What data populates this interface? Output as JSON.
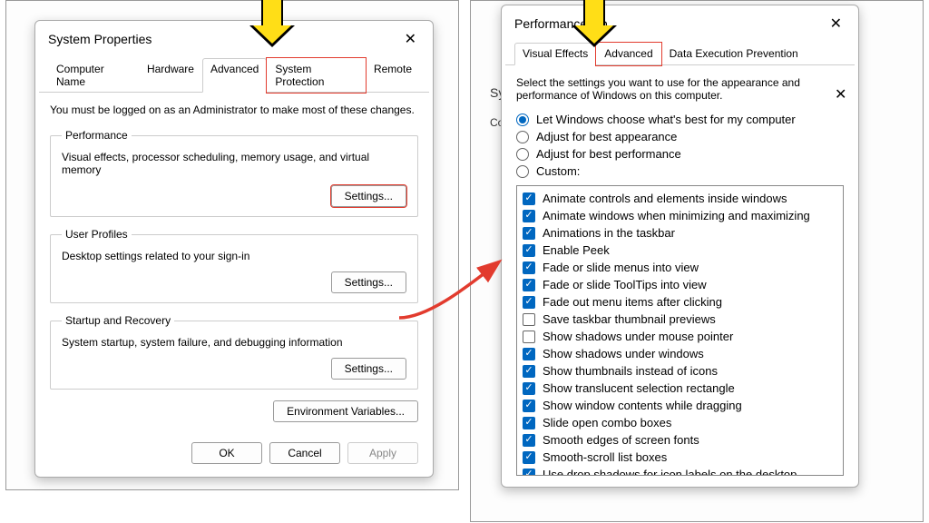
{
  "left": {
    "title": "System Properties",
    "tabs": [
      "Computer Name",
      "Hardware",
      "Advanced",
      "System Protection",
      "Remote"
    ],
    "active_tab": 2,
    "highlight_tab": 3,
    "admin_note": "You must be logged on as an Administrator to make most of these changes.",
    "groups": [
      {
        "legend": "Performance",
        "desc": "Visual effects, processor scheduling, memory usage, and virtual memory",
        "button": "Settings...",
        "highlight_button": true
      },
      {
        "legend": "User Profiles",
        "desc": "Desktop settings related to your sign-in",
        "button": "Settings...",
        "highlight_button": false
      },
      {
        "legend": "Startup and Recovery",
        "desc": "System startup, system failure, and debugging information",
        "button": "Settings...",
        "highlight_button": false
      }
    ],
    "env_button": "Environment Variables...",
    "footer": {
      "ok": "OK",
      "cancel": "Cancel",
      "apply": "Apply"
    }
  },
  "right": {
    "title_visible": "Performance Op",
    "tabs": [
      "Visual Effects",
      "Advanced",
      "Data Execution Prevention"
    ],
    "active_tab": 0,
    "highlight_tab": 1,
    "intro": "Select the settings you want to use for the appearance and performance of Windows on this computer.",
    "radios": [
      {
        "label": "Let Windows choose what's best for my computer",
        "selected": true
      },
      {
        "label": "Adjust for best appearance",
        "selected": false
      },
      {
        "label": "Adjust for best performance",
        "selected": false
      },
      {
        "label": "Custom:",
        "selected": false
      }
    ],
    "checks": [
      {
        "label": "Animate controls and elements inside windows",
        "checked": true
      },
      {
        "label": "Animate windows when minimizing and maximizing",
        "checked": true
      },
      {
        "label": "Animations in the taskbar",
        "checked": true
      },
      {
        "label": "Enable Peek",
        "checked": true
      },
      {
        "label": "Fade or slide menus into view",
        "checked": true
      },
      {
        "label": "Fade or slide ToolTips into view",
        "checked": true
      },
      {
        "label": "Fade out menu items after clicking",
        "checked": true
      },
      {
        "label": "Save taskbar thumbnail previews",
        "checked": false
      },
      {
        "label": "Show shadows under mouse pointer",
        "checked": false
      },
      {
        "label": "Show shadows under windows",
        "checked": true
      },
      {
        "label": "Show thumbnails instead of icons",
        "checked": true
      },
      {
        "label": "Show translucent selection rectangle",
        "checked": true
      },
      {
        "label": "Show window contents while dragging",
        "checked": true
      },
      {
        "label": "Slide open combo boxes",
        "checked": true
      },
      {
        "label": "Smooth edges of screen fonts",
        "checked": true
      },
      {
        "label": "Smooth-scroll list boxes",
        "checked": true
      },
      {
        "label": "Use drop shadows for icon labels on the desktop",
        "checked": true
      }
    ]
  },
  "back": {
    "title_fragment": "Syst",
    "row_fragment": "Co"
  }
}
